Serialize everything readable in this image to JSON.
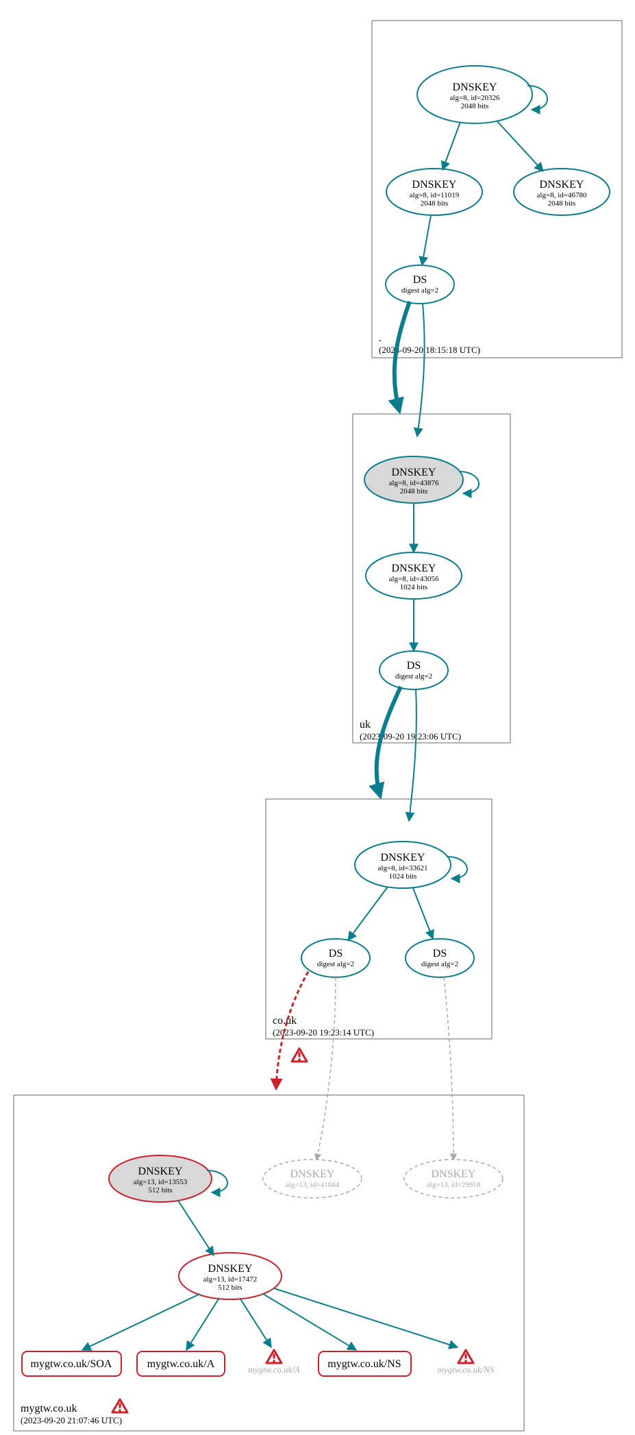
{
  "colors": {
    "teal": "#0a7e8c",
    "red": "#ce2029",
    "gray": "#aaaaaa",
    "nodeFill": "#d8d8d8"
  },
  "zones": {
    "root": {
      "label": ".",
      "time": "(2023-09-20 18:15:18 UTC)",
      "nodes": {
        "ksk": {
          "title": "DNSKEY",
          "line1": "alg=8, id=20326",
          "line2": "2048 bits"
        },
        "zsk1": {
          "title": "DNSKEY",
          "line1": "alg=8, id=11019",
          "line2": "2048 bits"
        },
        "zsk2": {
          "title": "DNSKEY",
          "line1": "alg=8, id=46780",
          "line2": "2048 bits"
        },
        "ds": {
          "title": "DS",
          "line1": "digest alg=2"
        }
      }
    },
    "uk": {
      "label": "uk",
      "time": "(2023-09-20 19:23:06 UTC)",
      "nodes": {
        "ksk": {
          "title": "DNSKEY",
          "line1": "alg=8, id=43876",
          "line2": "2048 bits"
        },
        "zsk": {
          "title": "DNSKEY",
          "line1": "alg=8, id=43056",
          "line2": "1024 bits"
        },
        "ds": {
          "title": "DS",
          "line1": "digest alg=2"
        }
      }
    },
    "couk": {
      "label": "co.uk",
      "time": "(2023-09-20 19:23:14 UTC)",
      "nodes": {
        "ksk": {
          "title": "DNSKEY",
          "line1": "alg=8, id=33621",
          "line2": "1024 bits"
        },
        "ds1": {
          "title": "DS",
          "line1": "digest alg=2"
        },
        "ds2": {
          "title": "DS",
          "line1": "digest alg=2"
        }
      }
    },
    "my": {
      "label": "mygtw.co.uk",
      "time": "(2023-09-20 21:07:46 UTC)",
      "nodes": {
        "ksk": {
          "title": "DNSKEY",
          "line1": "alg=13, id=13553",
          "line2": "512 bits"
        },
        "zsk": {
          "title": "DNSKEY",
          "line1": "alg=13, id=17472",
          "line2": "512 bits"
        },
        "ghost1": {
          "title": "DNSKEY",
          "line1": "alg=13, id=41044"
        },
        "ghost2": {
          "title": "DNSKEY",
          "line1": "alg=13, id=29918"
        },
        "soa": "mygtw.co.uk/SOA",
        "a": "mygtw.co.uk/A",
        "ns": "mygtw.co.uk/NS",
        "aGhost": "mygtw.co.uk/A",
        "nsGhost": "mygtw.co.uk/NS"
      }
    }
  }
}
